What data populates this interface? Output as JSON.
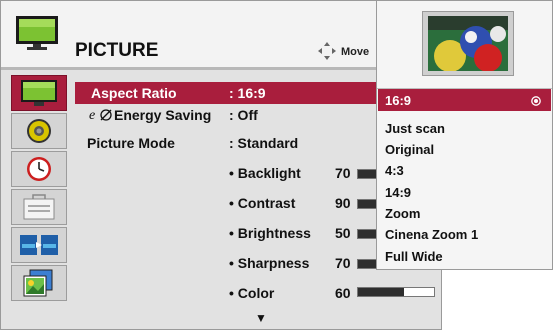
{
  "header": {
    "title": "PICTURE",
    "move_label": "Move"
  },
  "sidebar": {
    "items": [
      {
        "name": "picture",
        "icon": "tv-icon",
        "active": true
      },
      {
        "name": "audio",
        "icon": "speaker-icon",
        "active": false
      },
      {
        "name": "time",
        "icon": "clock-icon",
        "active": false
      },
      {
        "name": "option",
        "icon": "toolbox-icon",
        "active": false
      },
      {
        "name": "input",
        "icon": "input-icon",
        "active": false
      },
      {
        "name": "usb",
        "icon": "photo-icon",
        "active": false
      }
    ]
  },
  "settings": {
    "aspect_ratio": {
      "label": "Aspect Ratio",
      "value": ": 16:9"
    },
    "energy_saving": {
      "label": "Energy Saving",
      "value": ": Off"
    },
    "picture_mode": {
      "label": "Picture Mode",
      "value": ": Standard"
    },
    "sliders": [
      {
        "label": "• Backlight",
        "value": "70",
        "level": 0.7
      },
      {
        "label": "• Contrast",
        "value": "90",
        "level": 0.9
      },
      {
        "label": "• Brightness",
        "value": "50",
        "level": 0.5
      },
      {
        "label": "• Sharpness",
        "value": "70",
        "level": 0.7
      },
      {
        "label": "• Color",
        "value": "60",
        "level": 0.6
      }
    ],
    "more_indicator": "▼"
  },
  "aspect_popup": {
    "selected": "16:9",
    "options": [
      "16:9",
      "Just scan",
      "Original",
      "4:3",
      "14:9",
      "Zoom",
      "Cinena Zoom 1",
      "Full Wide"
    ]
  },
  "colors": {
    "highlight": "#a91e3d",
    "panel": "#e2e2e2",
    "tv_screen": "#7cc232"
  }
}
